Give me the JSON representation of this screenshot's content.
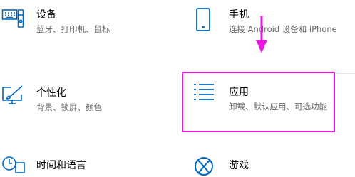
{
  "settings": {
    "devices": {
      "title": "设备",
      "desc": "蓝牙、打印机、鼠标"
    },
    "phone": {
      "title": "手机",
      "desc": "连接 Android 设备和 iPhone"
    },
    "personalization": {
      "title": "个性化",
      "desc": "背景、锁屏、颜色"
    },
    "apps": {
      "title": "应用",
      "desc": "卸载、默认应用、可选功能"
    },
    "time_language": {
      "title": "时间和语言"
    },
    "gaming": {
      "title": "游戏"
    }
  },
  "colors": {
    "icon_blue": "#0067c0",
    "highlight": "#e818e0"
  },
  "icons": [
    "keyboard-icon",
    "phone-icon",
    "brush-monitor-icon",
    "apps-list-icon",
    "clock-language-icon",
    "xbox-icon",
    "arrow-down-icon"
  ]
}
